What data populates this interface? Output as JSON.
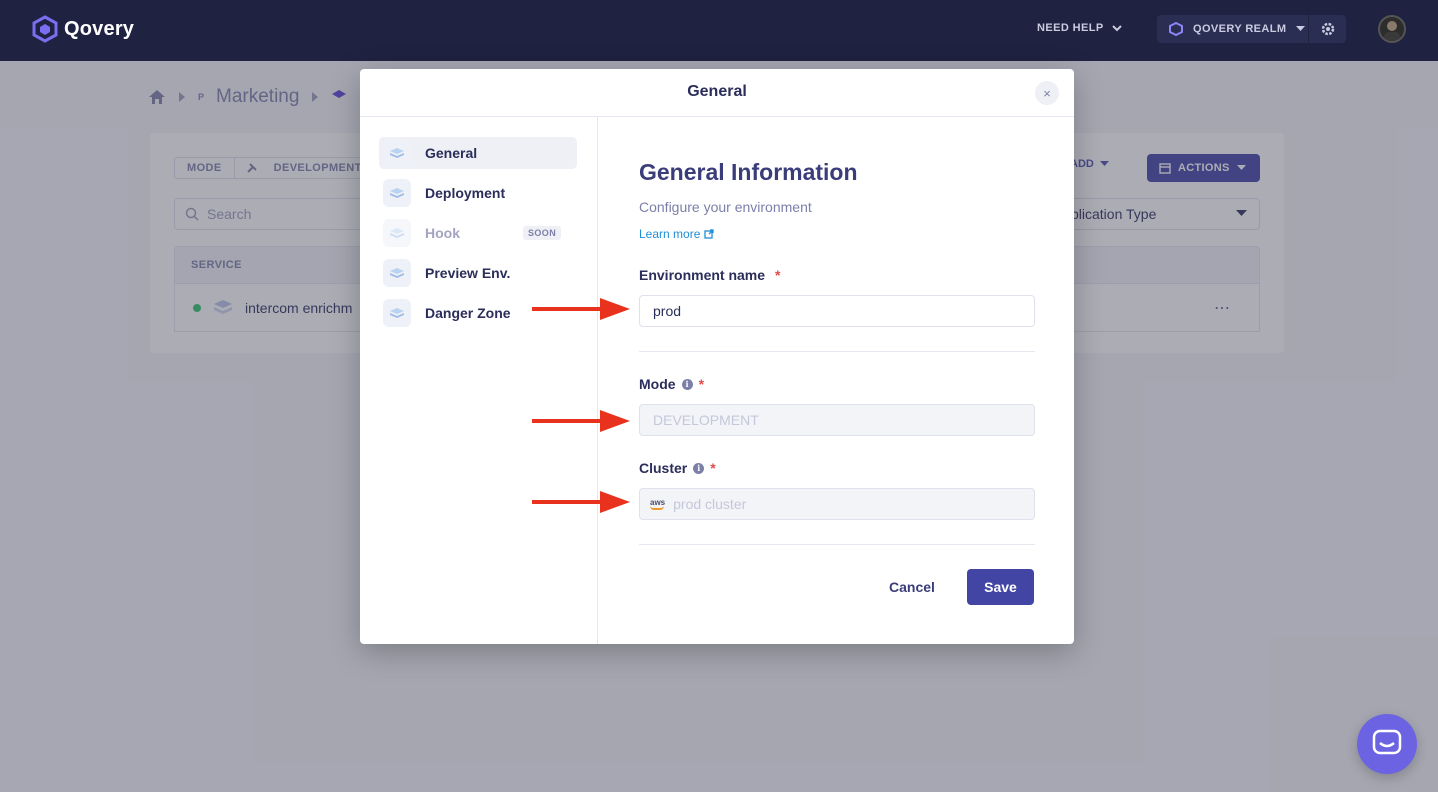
{
  "topnav": {
    "brand": "Qovery",
    "need_help": "NEED HELP",
    "realm": "QOVERY REALM"
  },
  "background": {
    "breadcrumb": {
      "project_badge": "P",
      "project": "Marketing"
    },
    "mode_label": "MODE",
    "mode_value": "DEVELOPMENT",
    "search_placeholder": "Search",
    "add_label": "ADD",
    "actions_label": "ACTIONS",
    "app_type_filter": "plication Type",
    "table_header": "SERVICE",
    "rows": [
      {
        "name": "intercom enrichm",
        "status_color": "#2fc36c"
      }
    ]
  },
  "modal": {
    "title": "General",
    "close": "×",
    "side_items": [
      {
        "label": "General",
        "active": true
      },
      {
        "label": "Deployment"
      },
      {
        "label": "Hook",
        "disabled": true,
        "badge": "SOON"
      },
      {
        "label": "Preview Env."
      },
      {
        "label": "Danger Zone"
      }
    ],
    "content": {
      "title": "General Information",
      "subtitle": "Configure your environment",
      "learn_more": "Learn more",
      "env_name_label": "Environment name",
      "env_name_value": "prod",
      "mode_label": "Mode",
      "mode_value": "DEVELOPMENT",
      "cluster_label": "Cluster",
      "cluster_provider": "aws",
      "cluster_value": "prod cluster",
      "required_mark": "*",
      "info_mark": "i",
      "cancel": "Cancel",
      "save": "Save"
    }
  },
  "colors": {
    "nav_bg": "#1f2240",
    "primary": "#4345a5",
    "required": "#e34b4b",
    "link": "#1f8fd6",
    "arrow": "#e8321d",
    "chat": "#6b63e2"
  },
  "icons": [
    "qovery-logo-icon",
    "chevron-down-icon",
    "realm-icon",
    "gear-icon",
    "home-icon",
    "search-icon",
    "wrench-icon",
    "calendar-icon",
    "close-icon",
    "external-link-icon",
    "info-icon",
    "aws-icon",
    "chat-icon"
  ]
}
